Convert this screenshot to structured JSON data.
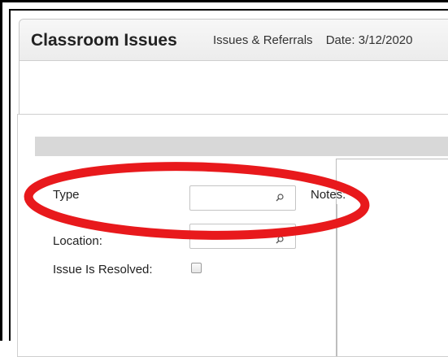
{
  "header": {
    "title": "Classroom Issues",
    "tab_label": "Issues & Referrals",
    "date_text": "Date: 3/12/2020"
  },
  "form": {
    "type_label": "Type",
    "type_value": "",
    "notes_label": "Notes:",
    "location_label": "Location:",
    "location_value": "",
    "resolved_label": "Issue Is Resolved:",
    "resolved_checked": false
  },
  "icons": {
    "lookup": "search-icon"
  },
  "colors": {
    "annotation_red": "#e8191c",
    "panel_bar": "#d8d8d8"
  }
}
